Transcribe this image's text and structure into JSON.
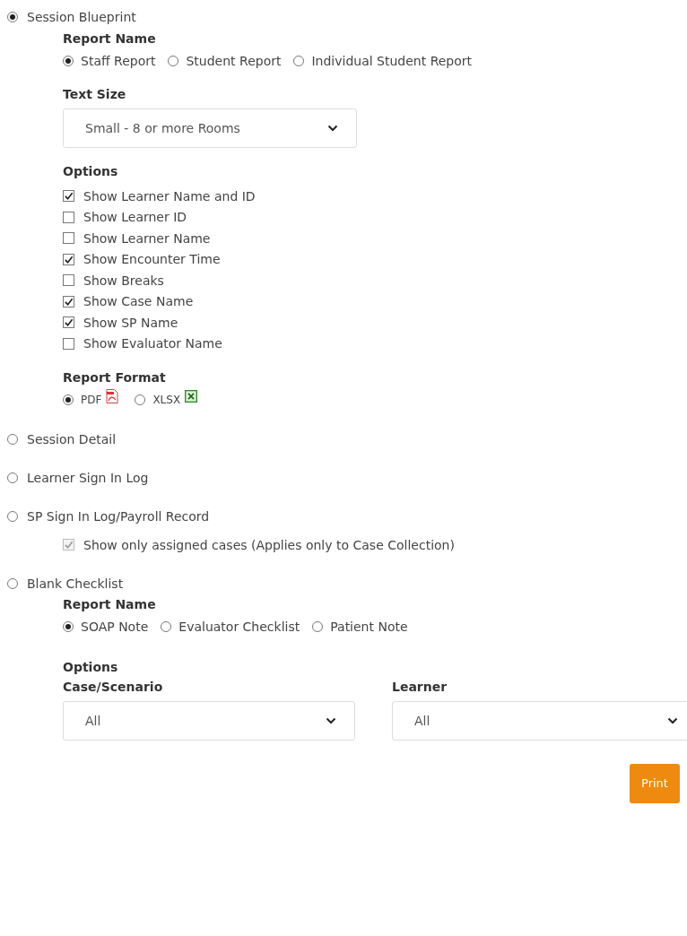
{
  "reports": [
    {
      "label": "Session Blueprint",
      "selected": true
    },
    {
      "label": "Session Detail",
      "selected": false
    },
    {
      "label": "Learner Sign In Log",
      "selected": false
    },
    {
      "label": "SP Sign In Log/Payroll Record",
      "selected": false
    },
    {
      "label": "Blank Checklist",
      "selected": false
    }
  ],
  "blueprint": {
    "report_name": {
      "heading": "Report Name",
      "options": [
        {
          "label": "Staff Report",
          "selected": true
        },
        {
          "label": "Student Report",
          "selected": false
        },
        {
          "label": "Individual Student Report",
          "selected": false
        }
      ]
    },
    "text_size": {
      "heading": "Text Size",
      "value": "Small - 8 or more Rooms"
    },
    "options": {
      "heading": "Options",
      "items": [
        {
          "label": "Show Learner Name and ID",
          "checked": true
        },
        {
          "label": "Show Learner ID",
          "checked": false
        },
        {
          "label": "Show Learner Name",
          "checked": false
        },
        {
          "label": "Show Encounter Time",
          "checked": true
        },
        {
          "label": "Show Breaks",
          "checked": false
        },
        {
          "label": "Show Case Name",
          "checked": true
        },
        {
          "label": "Show SP Name",
          "checked": true
        },
        {
          "label": "Show Evaluator Name",
          "checked": false
        }
      ]
    },
    "report_format": {
      "heading": "Report Format",
      "options": [
        {
          "label": "PDF",
          "selected": true,
          "kind": "pdf"
        },
        {
          "label": "XLSX",
          "selected": false,
          "kind": "xlsx"
        }
      ]
    }
  },
  "sp_option": {
    "label": "Show only assigned cases (Applies only to Case Collection)",
    "checked": true,
    "disabled": true
  },
  "checklist": {
    "report_name": {
      "heading": "Report Name",
      "options": [
        {
          "label": "SOAP Note",
          "selected": true
        },
        {
          "label": "Evaluator Checklist",
          "selected": false
        },
        {
          "label": "Patient Note",
          "selected": false
        }
      ]
    },
    "options_heading": "Options",
    "selects": [
      {
        "label": "Case/Scenario",
        "value": "All"
      },
      {
        "label": "Learner",
        "value": "All"
      }
    ]
  },
  "print_button": "Print"
}
